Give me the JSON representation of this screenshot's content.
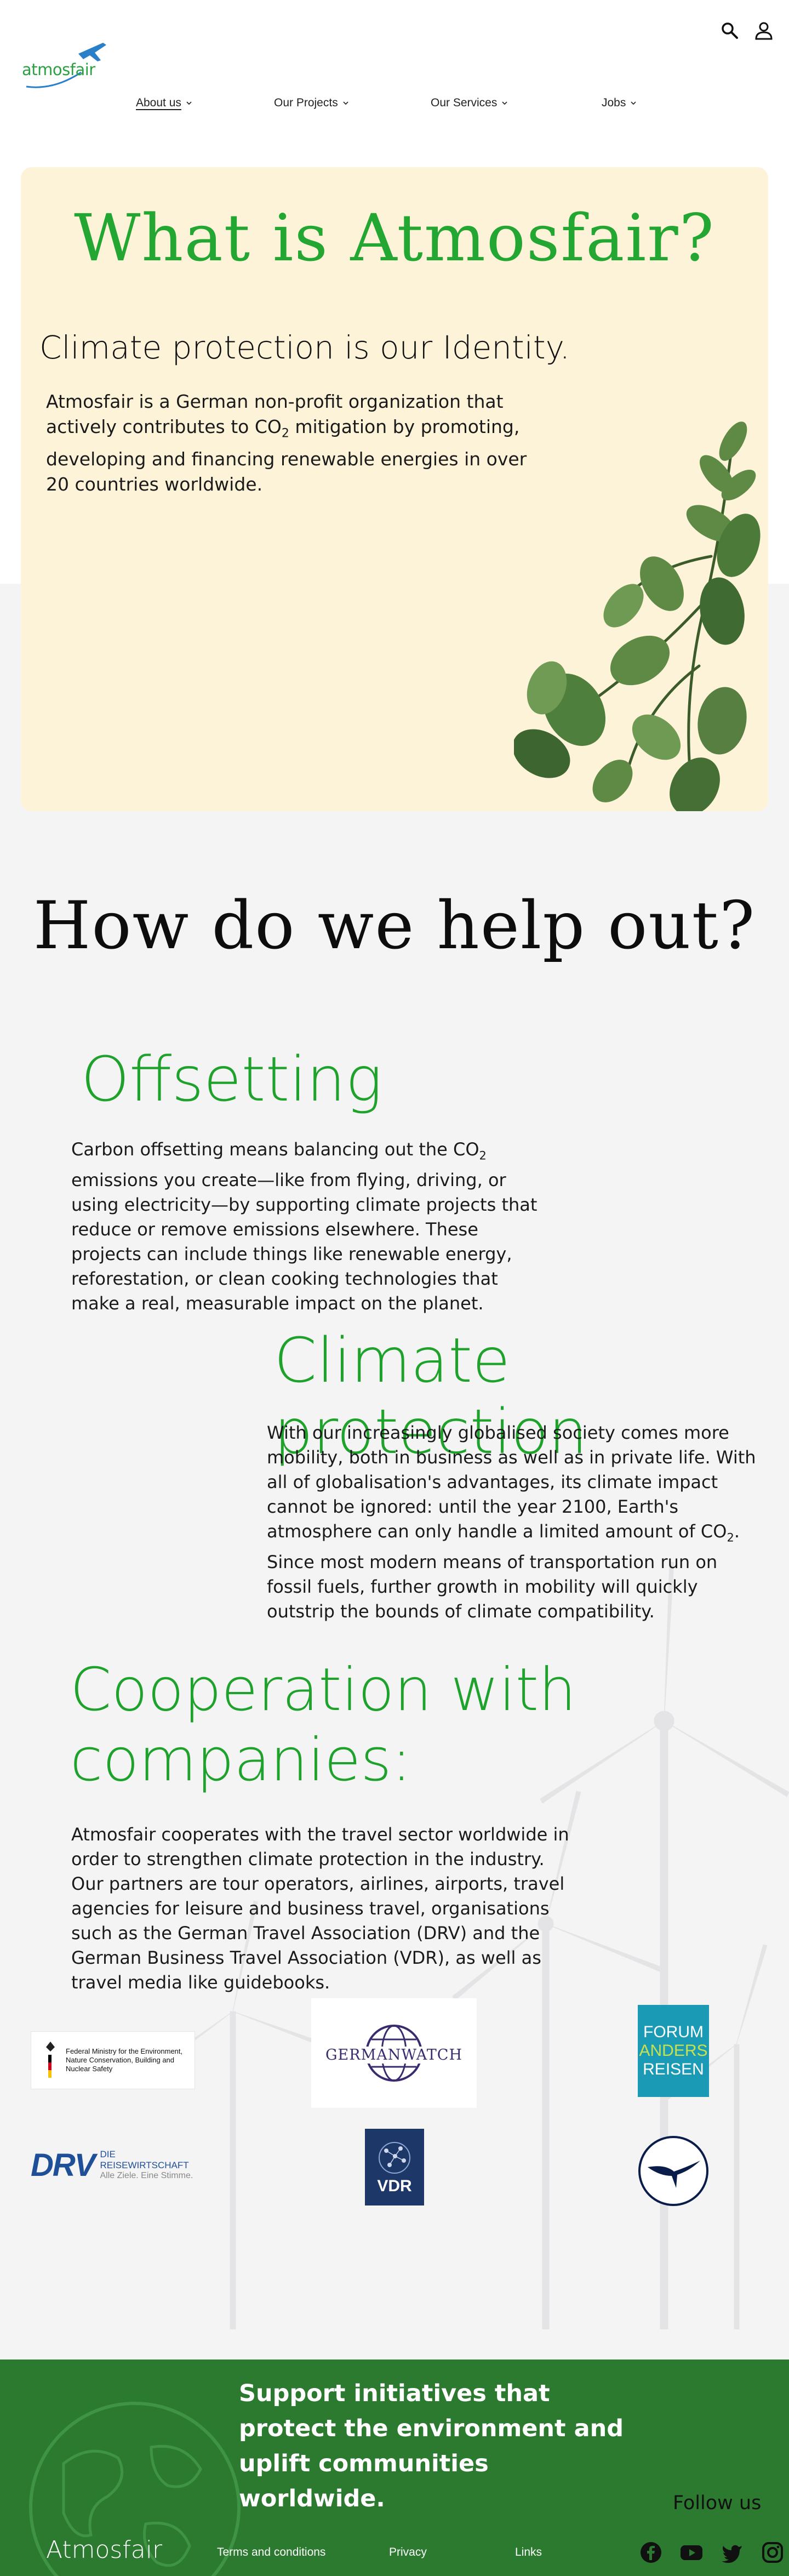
{
  "header": {
    "logo_text": "atmosfair",
    "nav": [
      {
        "label": "About us"
      },
      {
        "label": "Our Projects"
      },
      {
        "label": "Our Services"
      },
      {
        "label": "Jobs"
      }
    ]
  },
  "hero": {
    "title": "What is Atmosfair?",
    "subtitle": "Climate protection is our Identity.",
    "body_1": "Atmosfair is a German non-profit organization that actively contributes to CO",
    "body_sub": "2",
    "body_2": " mitigation by promoting, developing and financing renewable energies in over 20 countries worldwide."
  },
  "help": {
    "title": "How do we help out?"
  },
  "offsetting": {
    "heading": "Offsetting",
    "body_1": "Carbon offsetting means balancing out the CO",
    "body_sub": "2",
    "body_2": " emissions you create—like from flying, driving, or using electricity—by supporting climate projects that reduce or remove emissions elsewhere. These projects can include things like renewable energy, reforestation, or clean cooking technologies that make a real, measurable impact on the planet."
  },
  "climate": {
    "heading": "Climate protection",
    "body_1": "With our increasingly globalised society comes more mobility, both in business as well as in private life. With all of globalisation's advantages, its climate impact cannot be ignored: until the year 2100, Earth's atmosphere can only handle a limited amount of CO",
    "body_sub": "2",
    "body_2": ". Since most modern means of transportation run on fossil fuels, further growth in mobility will quickly outstrip the bounds of climate compatibility."
  },
  "cooperation": {
    "heading": "Cooperation with companies:",
    "body": "Atmosfair cooperates with the travel sector worldwide in order to strengthen climate protection in the industry. Our partners are tour operators, airlines, airports, travel agencies for leisure and business travel, organisations such as the German Travel Association (DRV) and the German Business Travel Association (VDR), as well as travel media like guidebooks."
  },
  "partners": {
    "bmu_text": "Federal Ministry for the Environment, Nature Conservation, Building and Nuclear Safety",
    "germanwatch": "GERMANWATCH",
    "forum_1": "FORUM",
    "forum_2": "ANDERS",
    "forum_3": "REISEN",
    "drv_logo": "DRV",
    "drv_name": "DIE REISEWIRTSCHAFT",
    "drv_claim": "Alle Ziele. Eine Stimme.",
    "vdr": "VDR"
  },
  "footer": {
    "tagline": "Support initiatives that protect the environment and uplift communities worldwide.",
    "follow": "Follow us",
    "brand": "Atmosfair",
    "links": [
      "Terms and conditions",
      "Privacy",
      "Links"
    ]
  },
  "colors": {
    "green": "#23a632",
    "hero_bg": "#fdf3d8",
    "footer_bg": "#2b7a30",
    "band": "#f4f4f5"
  },
  "icons": [
    "search-icon",
    "user-icon",
    "chevron-down-icon",
    "facebook-icon",
    "youtube-icon",
    "twitter-icon",
    "instagram-icon",
    "plane-icon",
    "plant-image",
    "globe-icon"
  ]
}
